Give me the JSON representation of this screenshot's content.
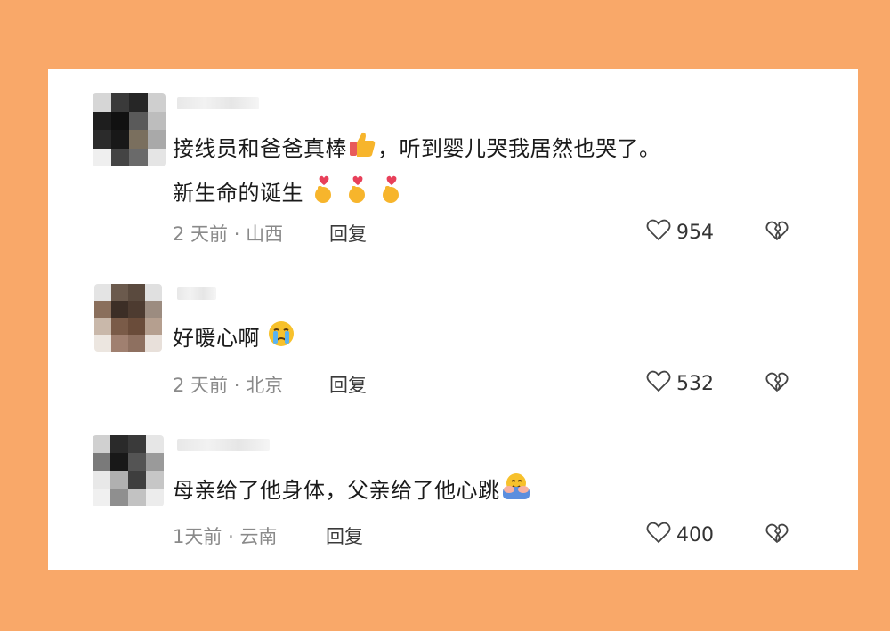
{
  "comments": [
    {
      "text_line1": "接线员和爸爸真棒",
      "text_line1_after": "，听到婴儿哭我居然也哭了。",
      "text_line2": "新生命的诞生",
      "time": "2 天前",
      "location": "山西",
      "reply_label": "回复",
      "likes": "954",
      "emojis": [
        "thumbs-up-icon",
        "finger-heart-icon",
        "finger-heart-icon",
        "finger-heart-icon"
      ]
    },
    {
      "text_line1": "好暖心啊",
      "time": "2 天前",
      "location": "北京",
      "reply_label": "回复",
      "likes": "532",
      "emojis": [
        "crying-face-icon"
      ]
    },
    {
      "text_line1": "母亲给了他身体，父亲给了他心跳",
      "time": "1天前",
      "location": "云南",
      "reply_label": "回复",
      "likes": "400",
      "emojis": [
        "hugging-face-icon"
      ]
    }
  ],
  "separator": "·",
  "colors": {
    "background": "#f9a869",
    "panel": "#ffffff",
    "meta": "#8a8a8a",
    "text": "#1a1a1a"
  }
}
